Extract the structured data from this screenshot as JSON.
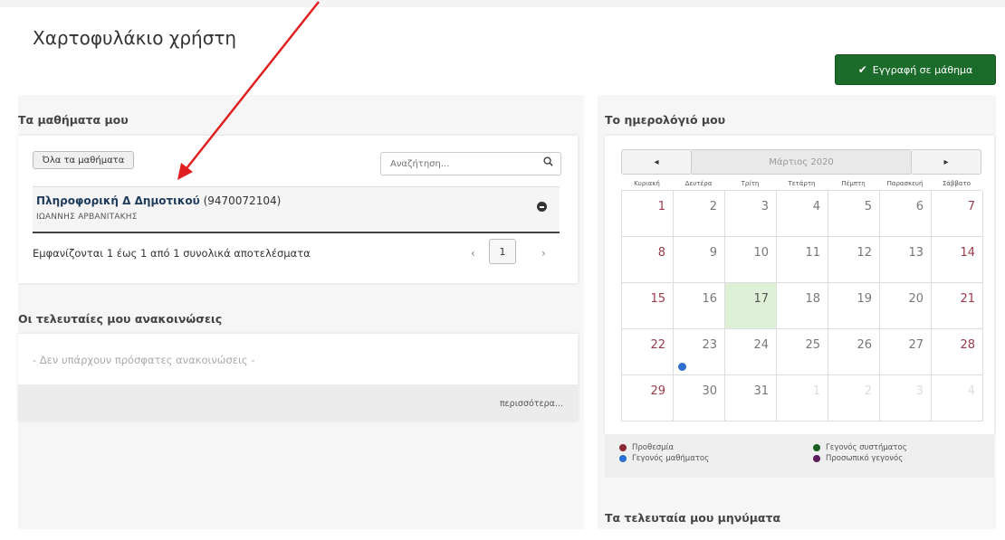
{
  "page": {
    "title": "Χαρτοφυλάκιο χρήστη",
    "enroll_button": "Εγγραφή σε μάθημα"
  },
  "my_courses": {
    "title": "Τα μαθήματα μου",
    "all_courses_button": "Όλα τα μαθήματα",
    "search_placeholder": "Αναζήτηση...",
    "courses": [
      {
        "name": "Πληροφορική Δ Δημοτικού",
        "code": "(9470072104)",
        "teacher": "ΙΩΑΝΝΗΣ ΑΡΒΑΝΙΤΑΚΗΣ"
      }
    ],
    "results_text": "Εμφανίζονται 1 έως 1 από 1 συνολικά αποτελέσματα",
    "pager": {
      "prev": "‹",
      "current": "1",
      "next": "›"
    }
  },
  "announcements": {
    "title": "Οι τελευταίες μου ανακοινώσεις",
    "empty_text": "- Δεν υπάρχουν πρόσφατες ανακοινώσεις -",
    "more_link": "περισσότερα..."
  },
  "calendar": {
    "title": "Το ημερολόγιό μου",
    "month_label": "Μάρτιος 2020",
    "prev_label": "◂",
    "next_label": "▸",
    "weekdays": [
      "Κυριακή",
      "Δευτέρα",
      "Τρίτη",
      "Τετάρτη",
      "Πέμπτη",
      "Παρασκευή",
      "Σάββατο"
    ],
    "weeks": [
      [
        "1",
        "2",
        "3",
        "4",
        "5",
        "6",
        "7"
      ],
      [
        "8",
        "9",
        "10",
        "11",
        "12",
        "13",
        "14"
      ],
      [
        "15",
        "16",
        "17",
        "18",
        "19",
        "20",
        "21"
      ],
      [
        "22",
        "23",
        "24",
        "25",
        "26",
        "27",
        "28"
      ],
      [
        "29",
        "30",
        "31",
        "1",
        "2",
        "3",
        "4"
      ]
    ],
    "today": "17",
    "legend": [
      {
        "label": "Προθεσμία",
        "color": "#8b2a35"
      },
      {
        "label": "Γεγονός συστήματος",
        "color": "#1b5e20"
      },
      {
        "label": "Γεγονός μαθήματος",
        "color": "#2c6fd1"
      },
      {
        "label": "Προσωπικό γεγονός",
        "color": "#5b1c5e"
      }
    ]
  },
  "messages": {
    "title": "Τα τελευταία μου μηνύματα"
  },
  "colors": {
    "accent": "#1b6b2a",
    "arrow": "#e02020"
  }
}
